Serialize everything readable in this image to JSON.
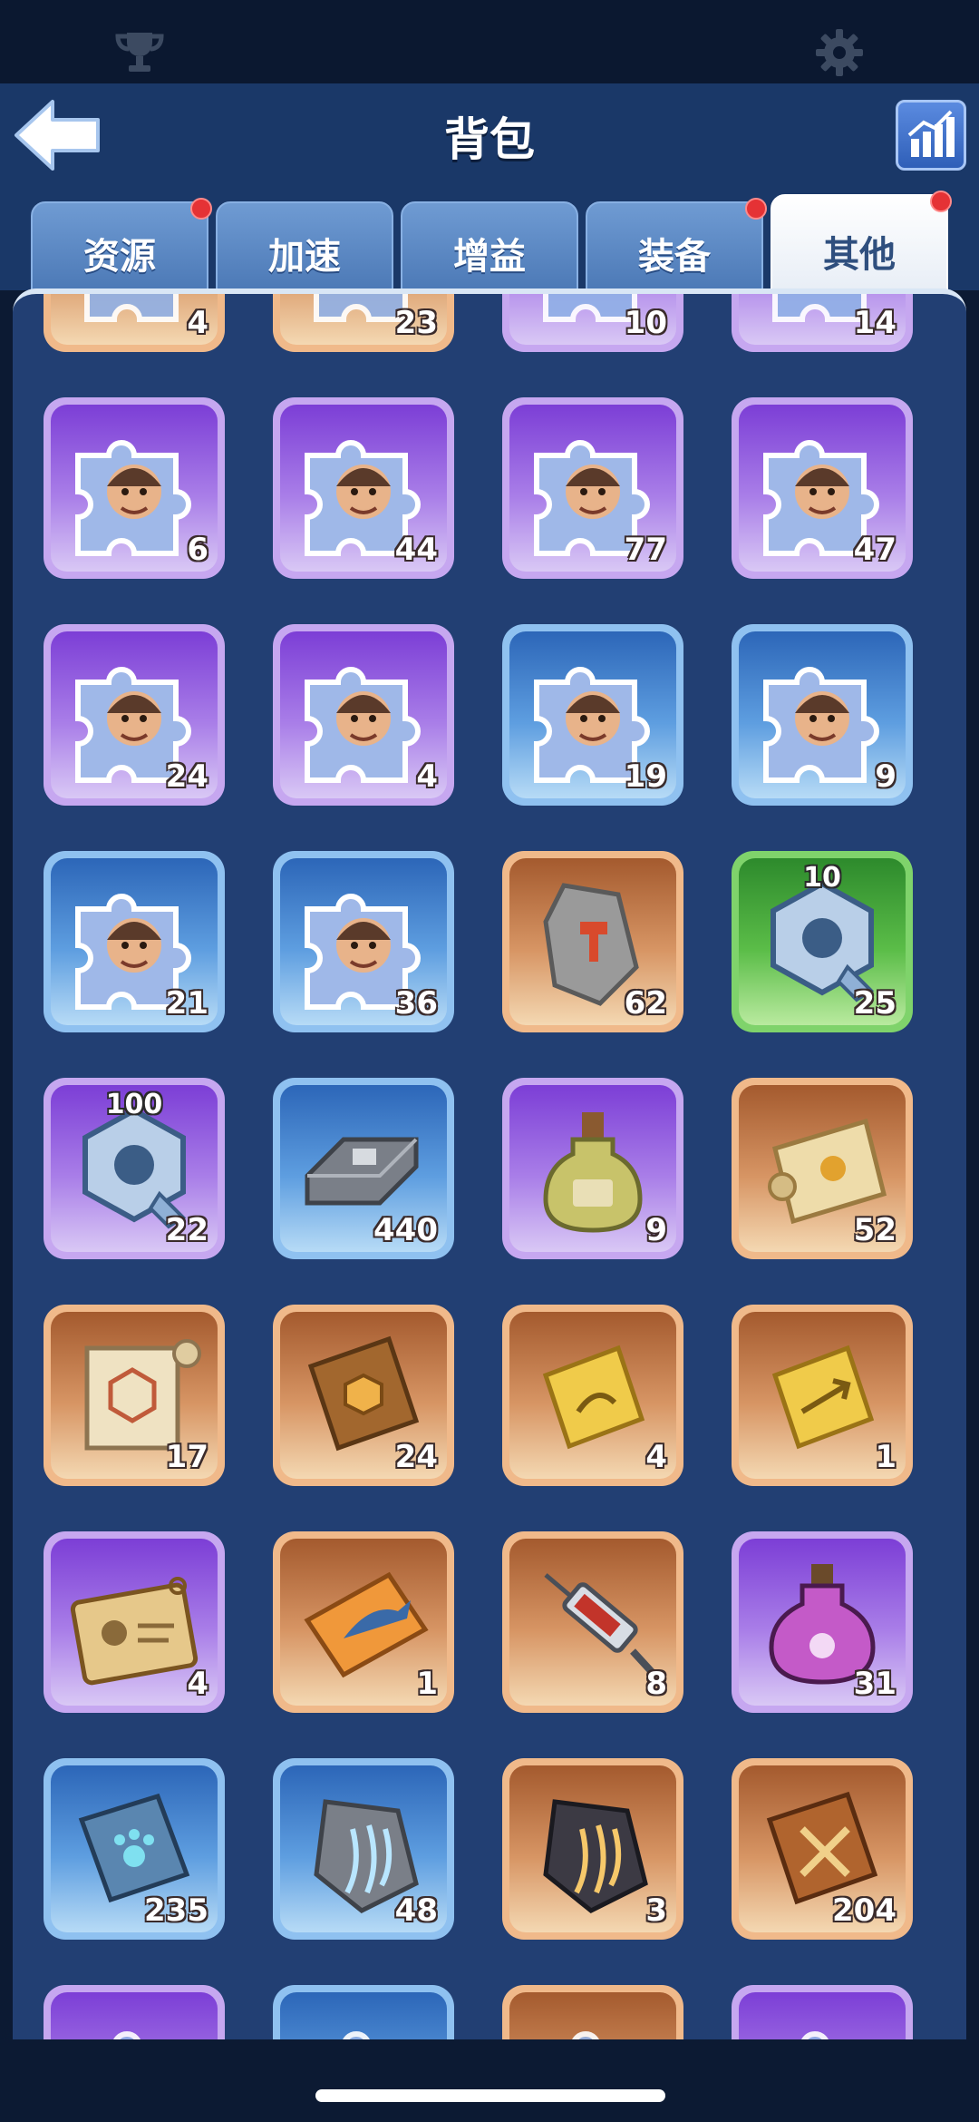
{
  "status_bar": {
    "left_icon": "trophy-icon",
    "right_icon": "gear-icon"
  },
  "header": {
    "title": "背包",
    "back_icon": "back-arrow-icon",
    "stats_icon": "bar-chart-icon"
  },
  "tabs": [
    {
      "label": "资源",
      "has_badge": true
    },
    {
      "label": "加速",
      "has_badge": false
    },
    {
      "label": "增益",
      "has_badge": false
    },
    {
      "label": "装备",
      "has_badge": true
    },
    {
      "label": "其他",
      "has_badge": true,
      "active": true
    }
  ],
  "items": [
    {
      "rarity": "orange",
      "icon": "puzzle-icon",
      "count": "4"
    },
    {
      "rarity": "orange",
      "icon": "puzzle-icon",
      "count": "23"
    },
    {
      "rarity": "purple",
      "icon": "puzzle-icon",
      "count": "10"
    },
    {
      "rarity": "purple",
      "icon": "puzzle-icon",
      "count": "14"
    },
    {
      "rarity": "purple",
      "icon": "hero-puzzle-icon",
      "count": "6"
    },
    {
      "rarity": "purple",
      "icon": "hero-puzzle-icon",
      "count": "44"
    },
    {
      "rarity": "purple",
      "icon": "hero-puzzle-icon",
      "count": "77"
    },
    {
      "rarity": "purple",
      "icon": "hero-puzzle-icon",
      "count": "47"
    },
    {
      "rarity": "purple",
      "icon": "hero-puzzle-icon",
      "count": "24"
    },
    {
      "rarity": "purple",
      "icon": "hero-puzzle-icon",
      "count": "4"
    },
    {
      "rarity": "blue",
      "icon": "hero-puzzle-icon",
      "count": "19"
    },
    {
      "rarity": "blue",
      "icon": "hero-puzzle-icon",
      "count": "9"
    },
    {
      "rarity": "blue",
      "icon": "hero-puzzle-icon",
      "count": "21"
    },
    {
      "rarity": "blue",
      "icon": "hero-puzzle-icon",
      "count": "36"
    },
    {
      "rarity": "orange",
      "icon": "hammer-stone-icon",
      "count": "62"
    },
    {
      "rarity": "green",
      "icon": "hex-nut-icon",
      "count": "25",
      "top_label": "10"
    },
    {
      "rarity": "purple",
      "icon": "hex-nut-icon",
      "count": "22",
      "top_label": "100"
    },
    {
      "rarity": "blue",
      "icon": "iron-ingot-icon",
      "count": "440"
    },
    {
      "rarity": "purple",
      "icon": "potion-bottle-icon",
      "count": "9"
    },
    {
      "rarity": "orange",
      "icon": "scroll-icon",
      "count": "52"
    },
    {
      "rarity": "orange",
      "icon": "blueprint-scroll-icon",
      "count": "17"
    },
    {
      "rarity": "orange",
      "icon": "gem-book-icon",
      "count": "24"
    },
    {
      "rarity": "orange",
      "icon": "gold-ticket-icon",
      "count": "4"
    },
    {
      "rarity": "orange",
      "icon": "gold-ticket-arrow-icon",
      "count": "1"
    },
    {
      "rarity": "purple",
      "icon": "id-tag-icon",
      "count": "4"
    },
    {
      "rarity": "orange",
      "icon": "fish-ticket-icon",
      "count": "1"
    },
    {
      "rarity": "orange",
      "icon": "syringe-icon",
      "count": "8"
    },
    {
      "rarity": "purple",
      "icon": "pink-potion-icon",
      "count": "31"
    },
    {
      "rarity": "blue",
      "icon": "paw-book-icon",
      "count": "235"
    },
    {
      "rarity": "blue",
      "icon": "claw-stone-icon",
      "count": "48"
    },
    {
      "rarity": "orange",
      "icon": "claw-stone-dark-icon",
      "count": "3"
    },
    {
      "rarity": "orange",
      "icon": "sword-book-icon",
      "count": "204"
    },
    {
      "rarity": "purple",
      "icon": "puzzle-icon",
      "count": ""
    },
    {
      "rarity": "blue",
      "icon": "puzzle-icon",
      "count": ""
    },
    {
      "rarity": "orange",
      "icon": "puzzle-icon",
      "count": ""
    },
    {
      "rarity": "purple",
      "icon": "puzzle-icon",
      "count": ""
    }
  ]
}
